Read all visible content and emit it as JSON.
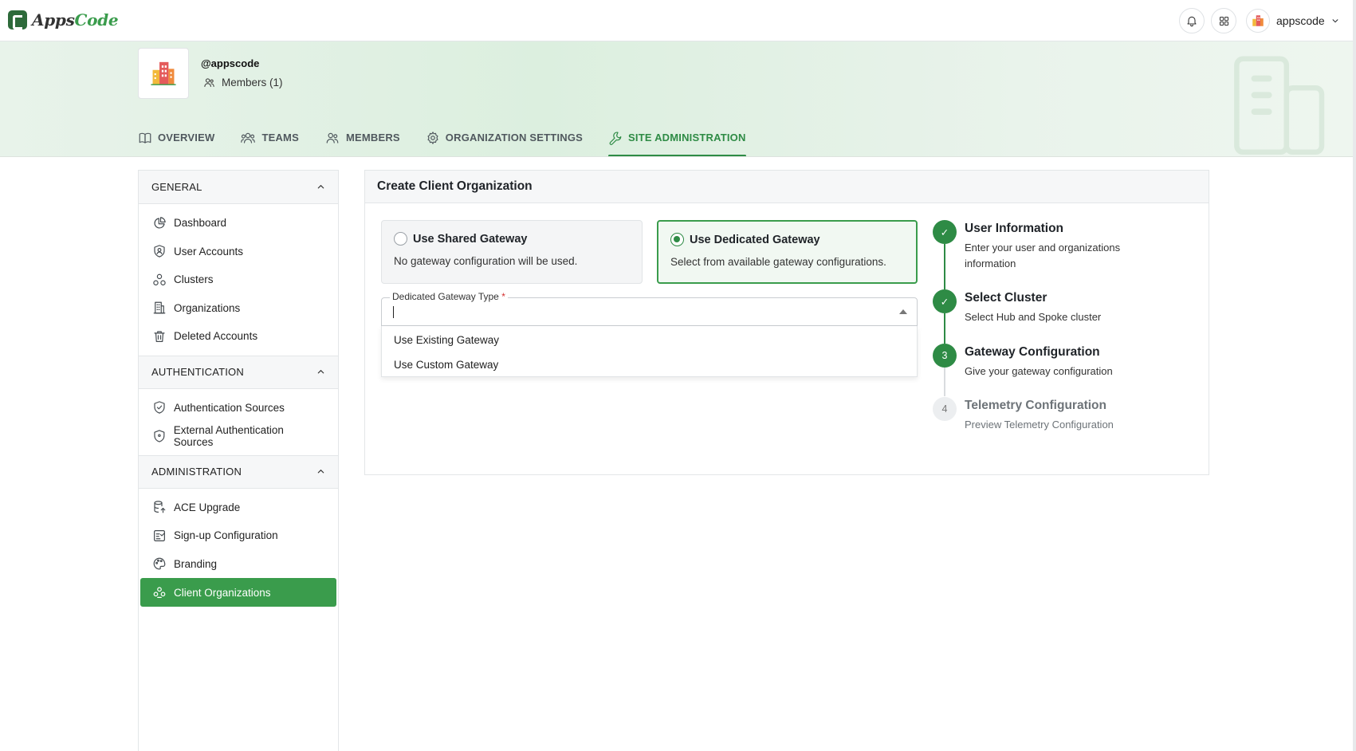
{
  "topbar": {
    "logo_prefix": "Apps",
    "logo_accent": "Code",
    "notifications_icon": "bell-icon",
    "apps_icon": "grid-icon",
    "user_name": "appscode",
    "user_menu_icon": "chevron-down-icon"
  },
  "org": {
    "handle": "@appscode",
    "members_label": "Members (1)"
  },
  "nav": {
    "tabs": [
      {
        "label": "OVERVIEW",
        "icon": "book-icon"
      },
      {
        "label": "TEAMS",
        "icon": "users-icon"
      },
      {
        "label": "MEMBERS",
        "icon": "users-icon"
      },
      {
        "label": "ORGANIZATION SETTINGS",
        "icon": "gear-icon"
      },
      {
        "label": "SITE ADMINISTRATION",
        "icon": "wrench-icon"
      }
    ],
    "active_index": 4
  },
  "sidebar": {
    "sections": [
      {
        "title": "GENERAL",
        "items": [
          {
            "label": "Dashboard",
            "icon": "pie-chart-icon"
          },
          {
            "label": "User Accounts",
            "icon": "user-shield-icon"
          },
          {
            "label": "Clusters",
            "icon": "clusters-icon"
          },
          {
            "label": "Organizations",
            "icon": "building-icon"
          },
          {
            "label": "Deleted Accounts",
            "icon": "trash-icon"
          }
        ]
      },
      {
        "title": "AUTHENTICATION",
        "items": [
          {
            "label": "Authentication Sources",
            "icon": "shield-check-icon"
          },
          {
            "label": "External Authentication Sources",
            "icon": "shield-icon"
          }
        ]
      },
      {
        "title": "ADMINISTRATION",
        "items": [
          {
            "label": "ACE Upgrade",
            "icon": "database-upgrade-icon"
          },
          {
            "label": "Sign-up Configuration",
            "icon": "form-check-icon"
          },
          {
            "label": "Branding",
            "icon": "palette-icon"
          },
          {
            "label": "Client Organizations",
            "icon": "client-org-icon"
          }
        ]
      }
    ],
    "active_item": "Client Organizations"
  },
  "main": {
    "title": "Create Client Organization",
    "gateway_options": [
      {
        "title": "Use Shared Gateway",
        "desc": "No gateway configuration will be used.",
        "selected": false
      },
      {
        "title": "Use Dedicated Gateway",
        "desc": "Select from available gateway configurations.",
        "selected": true
      }
    ],
    "gateway_type": {
      "label": "Dedicated Gateway Type",
      "required_mark": "*",
      "value": "",
      "options": [
        "Use Existing Gateway",
        "Use Custom Gateway"
      ]
    },
    "steps": [
      {
        "marker": "✓",
        "title": "User Information",
        "desc": "Enter your user and organizations information",
        "state": "done"
      },
      {
        "marker": "✓",
        "title": "Select Cluster",
        "desc": "Select Hub and Spoke cluster",
        "state": "done"
      },
      {
        "marker": "3",
        "title": "Gateway Configuration",
        "desc": "Give your gateway configuration",
        "state": "current"
      },
      {
        "marker": "4",
        "title": "Telemetry Configuration",
        "desc": "Preview Telemetry Configuration",
        "state": "todo"
      }
    ]
  },
  "colors": {
    "accent": "#2e8b45",
    "accent_light": "#3a9c4c",
    "header_band": "#e3f1e5"
  }
}
